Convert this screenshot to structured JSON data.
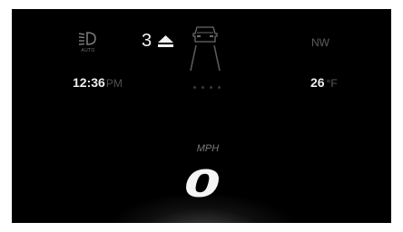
{
  "status": {
    "headlight_mode": "AUTO",
    "gear": "3",
    "compass": "NW",
    "time": "12:36",
    "time_period": "PM",
    "temperature": "26",
    "temperature_unit": "°F"
  },
  "speed": {
    "unit_label": "MPH",
    "value": "0"
  },
  "icons": {
    "headlight": "auto-headlight-icon",
    "gear_shift": "shift-up-arrow-icon",
    "vehicle": "lane-vehicle-icon",
    "indicator": "page-dots-indicator"
  },
  "colors": {
    "background": "#000000",
    "primary_text": "#ededed",
    "dim_text": "#5c5c5c"
  }
}
